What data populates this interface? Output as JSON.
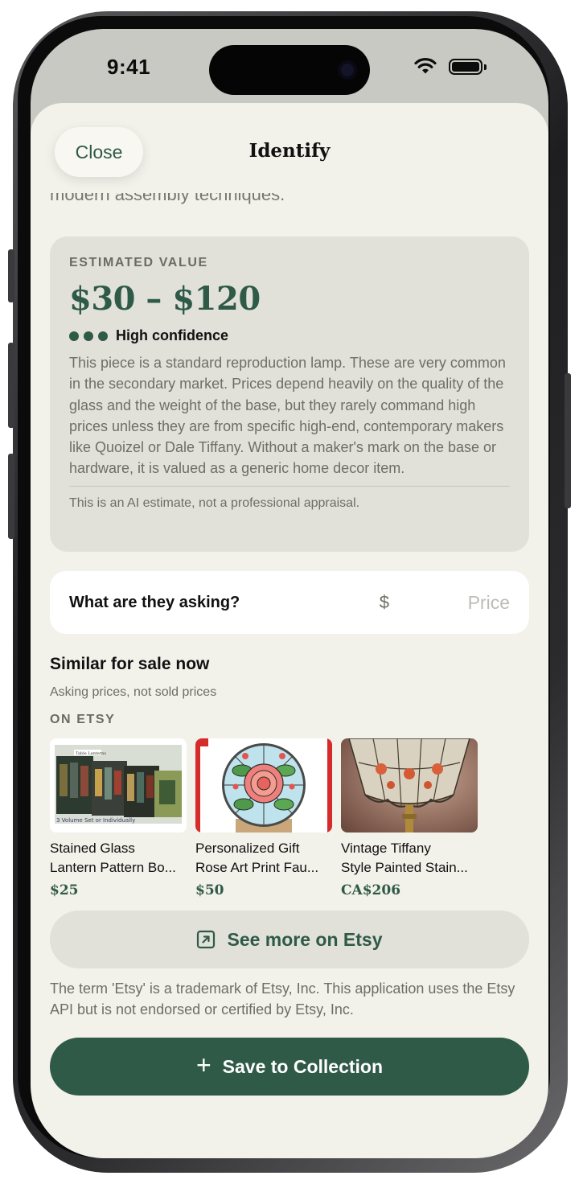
{
  "status_bar": {
    "time": "9:41"
  },
  "sheet": {
    "close_label": "Close",
    "title": "Identify",
    "previous_text_tail": "modern assembly techniques."
  },
  "estimated_value": {
    "label": "ESTIMATED VALUE",
    "range": "$30 – $120",
    "confidence_level": 3,
    "confidence_text": "High confidence",
    "description": "This piece is a standard reproduction lamp. These are very common in the secondary market. Prices depend heavily on the quality of the glass and the weight of the base, but they rarely command high prices unless they are from specific high-end, contemporary makers like Quoizel or Dale Tiffany. Without a maker's mark on the base or hardware, it is valued as a generic home decor item.",
    "disclaimer": "This is an AI estimate, not a professional appraisal."
  },
  "asking": {
    "label": "What are they asking?",
    "currency": "$",
    "placeholder": "Price",
    "value": ""
  },
  "similar": {
    "title": "Similar for sale now",
    "subtitle": "Asking prices, not sold prices",
    "source_label": "ON ETSY",
    "listings": [
      {
        "line1": "Stained Glass",
        "line2": "Lantern Pattern Bo...",
        "price": "$25",
        "image": "pattern-books-image"
      },
      {
        "line1": "Personalized Gift",
        "line2": "Rose Art Print Fau...",
        "price": "$50",
        "image": "rose-art-image"
      },
      {
        "line1": "Vintage Tiffany",
        "line2": "Style Painted Stain...",
        "price": "CA$206",
        "image": "tiffany-lamp-image"
      }
    ],
    "thumb_captions": {
      "book_top": "Table Lanterns",
      "book_footer": "3 Volume Set or Individually"
    },
    "see_more_label": "See more on Etsy",
    "trademark_notice": "The term 'Etsy' is a trademark of Etsy, Inc. This application uses the Etsy API but is not endorsed or certified by Etsy, Inc."
  },
  "actions": {
    "save_label": "Save to Collection"
  },
  "colors": {
    "accent": "#2f5a47",
    "sheet_background": "#f2f1ea",
    "card_background": "#e1e1da",
    "muted_text": "#6e6e66"
  }
}
